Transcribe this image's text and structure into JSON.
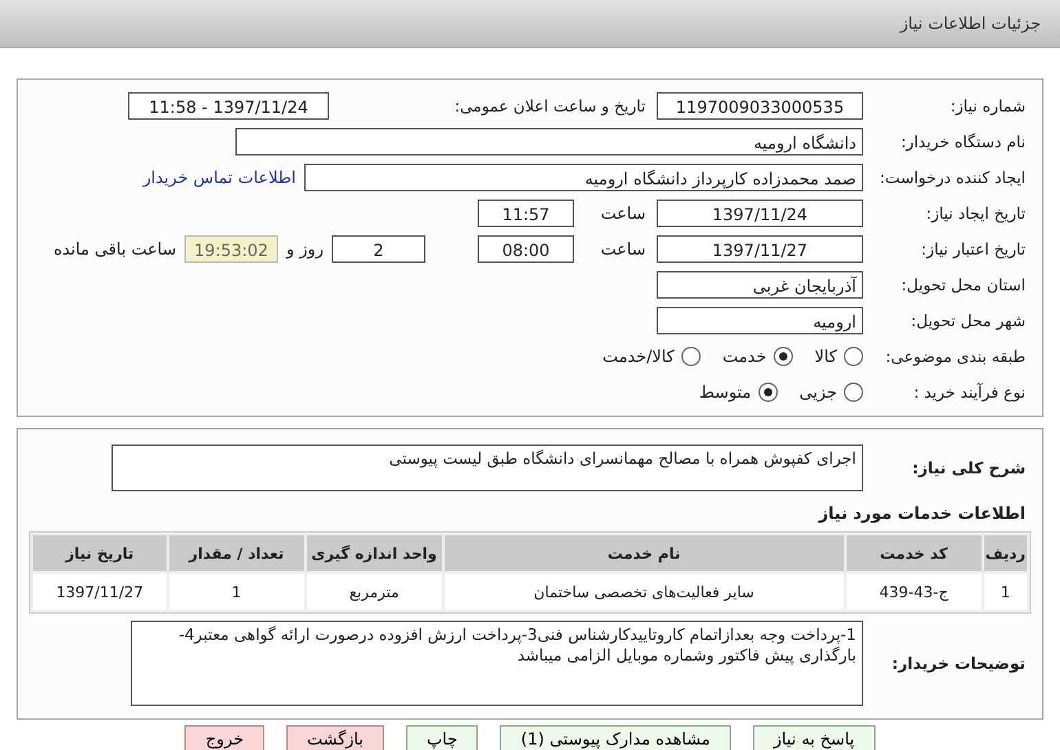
{
  "header": {
    "title": "جزئیات اطلاعات نیاز"
  },
  "need_number": {
    "label": "شماره نیاز:",
    "value": "1197009033000535"
  },
  "announce": {
    "label": "تاریخ و ساعت اعلان عمومی:",
    "value": "1397/11/24 - 11:58"
  },
  "buyer": {
    "label": "نام دستگاه خریدار:",
    "value": "دانشگاه ارومیه"
  },
  "requester": {
    "label": "ایجاد کننده درخواست:",
    "value": "صمد محمدزاده کارپرداز دانشگاه ارومیه",
    "link": "اطلاعات تماس خریدار"
  },
  "created": {
    "label": "تاریخ ایجاد نیاز:",
    "date": "1397/11/24",
    "time_label": "ساعت",
    "time": "11:57"
  },
  "validity": {
    "label": "تاریخ اعتبار نیاز:",
    "date": "1397/11/27",
    "time_label": "ساعت",
    "time": "08:00",
    "days": "2",
    "days_label": "روز و",
    "remaining": "19:53:02",
    "remaining_label": "ساعت باقی مانده"
  },
  "province": {
    "label": "استان محل تحویل:",
    "value": "آذربایجان غربی"
  },
  "city": {
    "label": "شهر محل تحویل:",
    "value": "ارومیه"
  },
  "category": {
    "label": "طبقه بندی موضوعی:",
    "options": [
      {
        "label": "کالا",
        "selected": false
      },
      {
        "label": "خدمت",
        "selected": true
      },
      {
        "label": "کالا/خدمت",
        "selected": false
      }
    ]
  },
  "process": {
    "label": "نوع فرآیند خرید :",
    "options": [
      {
        "label": "جزیی",
        "selected": false
      },
      {
        "label": "متوسط",
        "selected": true
      }
    ]
  },
  "description": {
    "label": "شرح کلی نیاز:",
    "value": "اجرای کفپوش  همراه با مصالح  مهمانسرای دانشگاه طبق لیست پیوستی"
  },
  "services": {
    "title": "اطلاعات خدمات مورد نیاز",
    "columns": [
      "ردیف",
      "کد خدمت",
      "نام خدمت",
      "واحد اندازه گیری",
      "تعداد / مقدار",
      "تاریخ نیاز"
    ],
    "rows": [
      [
        "1",
        "ج-43-439",
        "سایر فعالیت‌های تخصصی ساختمان",
        "مترمربع",
        "1",
        "1397/11/27"
      ]
    ]
  },
  "notes": {
    "label": "توضیحات خریدار:",
    "value": "1-پرداخت وجه بعدازاتمام کاروتاییدکارشناس فنی3-پرداخت ارزش افزوده درصورت ارائه گواهی معتبر4-بارگذاری پیش فاکتور وشماره موبایل الزامی میباشد"
  },
  "buttons": [
    {
      "label": "پاسخ به نیاز",
      "kind": "action"
    },
    {
      "label": "مشاهده مدارک پیوستی (1)",
      "kind": "action"
    },
    {
      "label": "چاپ",
      "kind": "action"
    },
    {
      "label": "بازگشت",
      "kind": "exit"
    },
    {
      "label": "خروج",
      "kind": "exit"
    }
  ]
}
